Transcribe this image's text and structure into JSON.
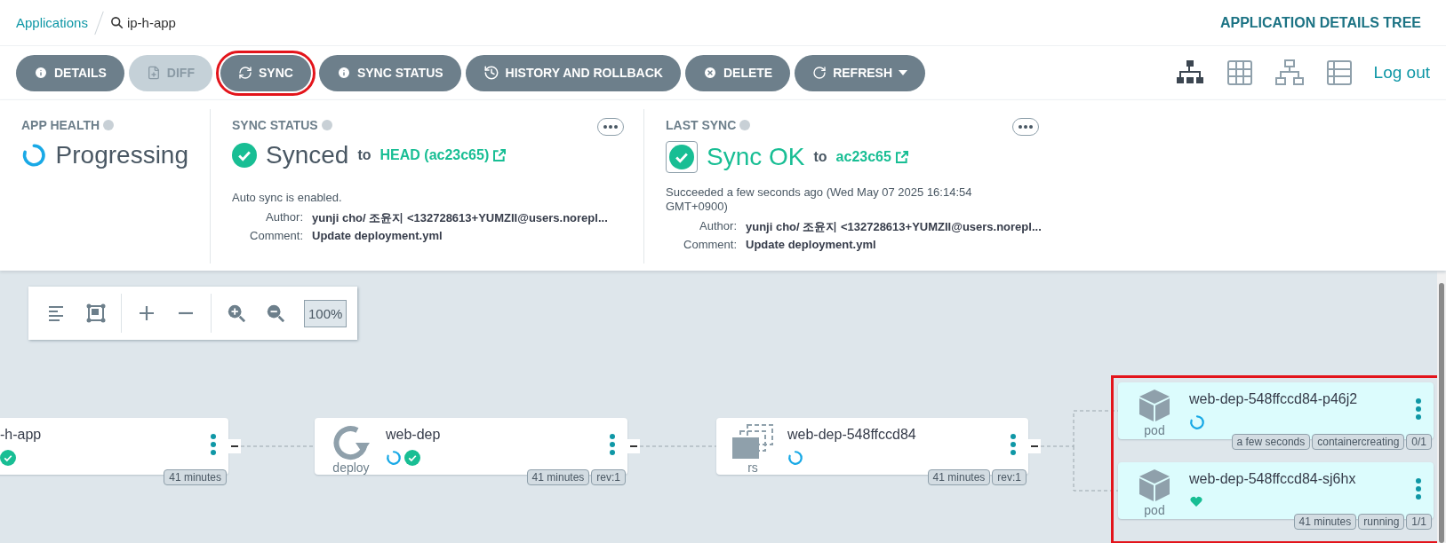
{
  "breadcrumb": {
    "root": "Applications",
    "current": "ip-h-app"
  },
  "page_title": "APPLICATION DETAILS TREE",
  "actions": [
    {
      "label": "DETAILS",
      "disabled": false,
      "annotated": false,
      "dropdown": false
    },
    {
      "label": "DIFF",
      "disabled": true,
      "annotated": false,
      "dropdown": false
    },
    {
      "label": "SYNC",
      "disabled": false,
      "annotated": true,
      "dropdown": false
    },
    {
      "label": "SYNC STATUS",
      "disabled": false,
      "annotated": false,
      "dropdown": false
    },
    {
      "label": "HISTORY AND ROLLBACK",
      "disabled": false,
      "annotated": false,
      "dropdown": false
    },
    {
      "label": "DELETE",
      "disabled": false,
      "annotated": false,
      "dropdown": false
    },
    {
      "label": "REFRESH",
      "disabled": false,
      "annotated": false,
      "dropdown": true
    }
  ],
  "views": [
    {
      "kind": "tree",
      "selected": true
    },
    {
      "kind": "grid",
      "selected": false
    },
    {
      "kind": "network",
      "selected": false
    },
    {
      "kind": "list",
      "selected": false
    }
  ],
  "logout": "Log out",
  "app_health": {
    "title": "APP HEALTH",
    "status": "Progressing"
  },
  "sync_status": {
    "title": "SYNC STATUS",
    "status": "Synced",
    "to": "to",
    "target": "HEAD (ac23c65)",
    "note": "Auto sync is enabled.",
    "author_label": "Author:",
    "author": "yunji cho/ 조윤지 <132728613+YUMZII@users.norepl...",
    "comment_label": "Comment:",
    "comment": "Update deployment.yml"
  },
  "last_sync": {
    "title": "LAST SYNC",
    "status": "Sync OK",
    "to": "to",
    "target": "ac23c65",
    "note": "Succeeded a few seconds ago (Wed May 07 2025 16:14:54 GMT+0900)",
    "author_label": "Author:",
    "author": "yunji cho/ 조윤지 <132728613+YUMZII@users.norepl...",
    "comment_label": "Comment:",
    "comment": "Update deployment.yml"
  },
  "zoom_level": "100%",
  "pods_annotated": true,
  "nodes": [
    {
      "name": "-h-app",
      "kind": "app",
      "progressing": false,
      "synced": true,
      "healthy": false,
      "tags": [
        "41 minutes"
      ]
    },
    {
      "name": "web-dep",
      "kind": "deploy",
      "kind_label": "deploy",
      "progressing": true,
      "synced": true,
      "healthy": false,
      "tags": [
        "41 minutes",
        "rev:1"
      ]
    },
    {
      "name": "web-dep-548ffccd84",
      "kind": "rs",
      "kind_label": "rs",
      "progressing": true,
      "synced": false,
      "healthy": false,
      "tags": [
        "41 minutes",
        "rev:1"
      ]
    },
    {
      "name": "web-dep-548ffccd84-p46j2",
      "kind": "pod",
      "kind_label": "pod",
      "progressing": true,
      "synced": false,
      "healthy": false,
      "tags": [
        "a few seconds",
        "containercreating",
        "0/1"
      ]
    },
    {
      "name": "web-dep-548ffccd84-sj6hx",
      "kind": "pod",
      "kind_label": "pod",
      "progressing": false,
      "synced": false,
      "healthy": true,
      "tags": [
        "41 minutes",
        "running",
        "1/1"
      ]
    }
  ]
}
